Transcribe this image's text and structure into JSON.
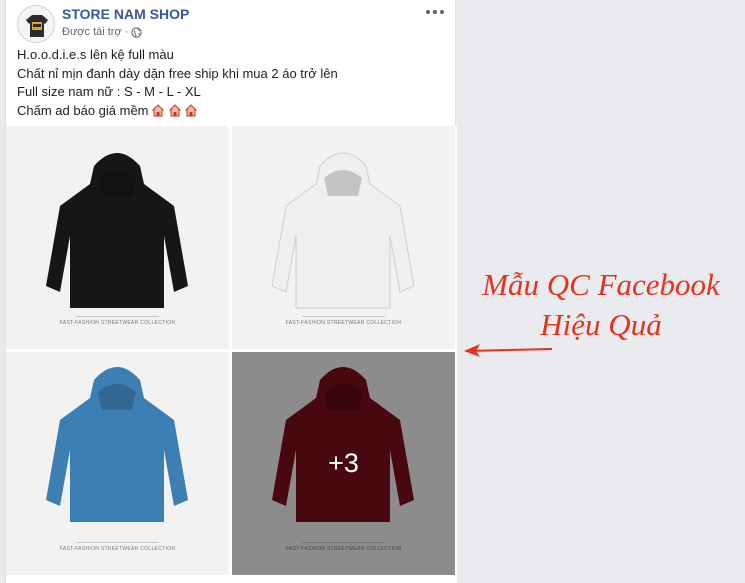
{
  "post": {
    "page_name": "STORE NAM SHOP",
    "sponsored_label": "Được tài trợ ·",
    "text_lines": [
      "H.o.o.d.i.e.s lên kệ full màu",
      "Chất nỉ mịn đanh dày dặn free ship khi mua 2 áo trở lên",
      "Full size nam nữ : S - M - L - XL",
      "Chấm ad báo giá mềm"
    ]
  },
  "photos": [
    {
      "color_name": "black",
      "hoodie_color": "#161616",
      "caption": "FAST-FASHION STREETWEAR COLLECTION"
    },
    {
      "color_name": "white",
      "hoodie_color": "#efefef",
      "caption": "FAST-FASHION STREETWEAR COLLECTION"
    },
    {
      "color_name": "blue",
      "hoodie_color": "#3d7fb3",
      "caption": "FAST-FASHION STREETWEAR COLLECTION"
    },
    {
      "color_name": "maroon",
      "hoodie_color": "#7a0f1d",
      "caption": "FAST-FASHION STREETWEAR COLLECTION"
    }
  ],
  "more_photos_label": "+3",
  "annotation": {
    "line1": "Mẫu QC Facebook",
    "line2": "Hiệu Quả",
    "color": "#e8321e"
  },
  "icons": {
    "more": "more-options-icon",
    "globe": "globe-icon",
    "emoji": "house-emoji-icon"
  }
}
